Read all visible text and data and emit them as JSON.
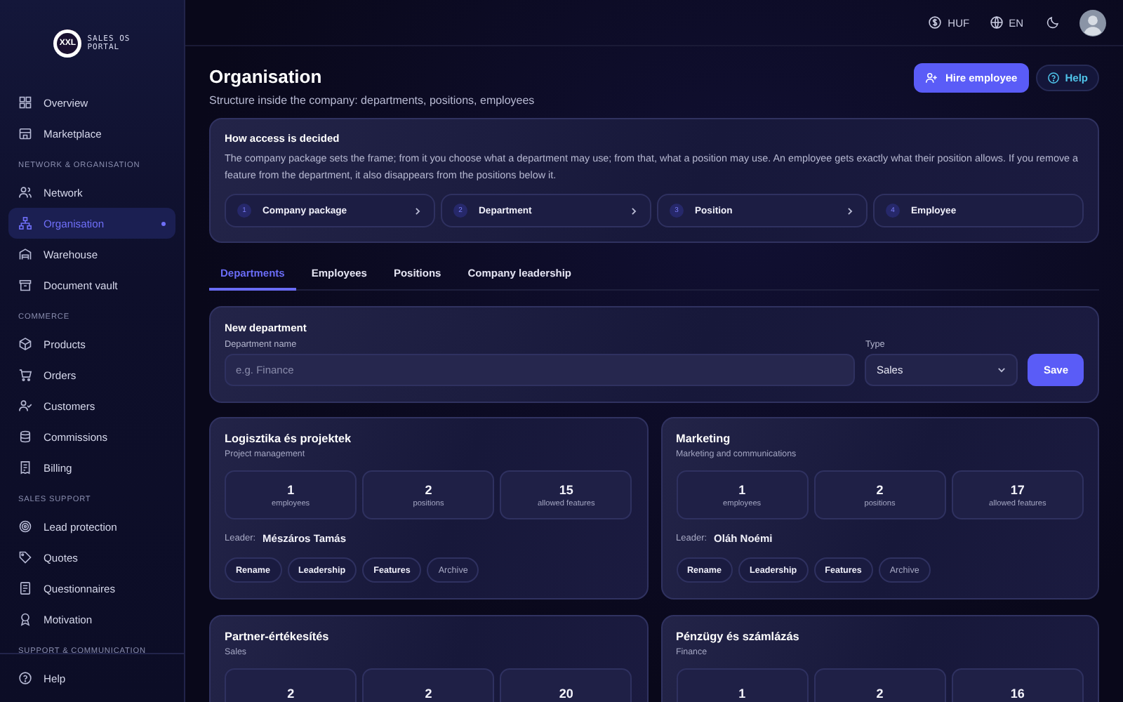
{
  "logo": {
    "mark": "XXL",
    "line_1": "SALES OS",
    "line_2": "PORTAL"
  },
  "sidebar": {
    "sections": [
      {
        "items": [
          {
            "label": "Overview",
            "selected": false
          },
          {
            "label": "Marketplace",
            "selected": false
          }
        ]
      },
      {
        "heading": "NETWORK & ORGANISATION",
        "items": [
          {
            "label": "Network",
            "selected": false
          },
          {
            "label": "Organisation",
            "selected": true
          },
          {
            "label": "Warehouse",
            "selected": false
          },
          {
            "label": "Document vault",
            "selected": false
          }
        ]
      },
      {
        "heading": "COMMERCE",
        "items": [
          {
            "label": "Products",
            "selected": false
          },
          {
            "label": "Orders",
            "selected": false
          },
          {
            "label": "Customers",
            "selected": false
          },
          {
            "label": "Commissions",
            "selected": false
          },
          {
            "label": "Billing",
            "selected": false
          }
        ]
      },
      {
        "heading": "SALES SUPPORT",
        "items": [
          {
            "label": "Lead protection",
            "selected": false
          },
          {
            "label": "Quotes",
            "selected": false
          },
          {
            "label": "Questionnaires",
            "selected": false
          },
          {
            "label": "Motivation",
            "selected": false
          }
        ]
      },
      {
        "heading": "SUPPORT & COMMUNICATION"
      }
    ],
    "footer": {
      "label": "Help"
    }
  },
  "topbar": {
    "currency": "HUF",
    "language": "EN"
  },
  "header": {
    "title": "Organisation",
    "subtitle": "Structure inside the company: departments, positions, employees",
    "primary_button": "Hire employee",
    "help_button": "Help"
  },
  "info": {
    "title": "How access is decided",
    "text": "The company package sets the frame; from it you choose what a department may use; from that, what a position may use. An employee gets exactly what their position allows. If you remove a feature from the department, it also disappears from the positions below it.",
    "steps": [
      {
        "number": "1",
        "label": "Company package"
      },
      {
        "number": "2",
        "label": "Department"
      },
      {
        "number": "3",
        "label": "Position"
      },
      {
        "number": "4",
        "label": "Employee"
      }
    ]
  },
  "tabs": [
    {
      "label": "Departments",
      "selected": true
    },
    {
      "label": "Employees",
      "selected": false
    },
    {
      "label": "Positions",
      "selected": false
    },
    {
      "label": "Company leadership",
      "selected": false
    }
  ],
  "new_department": {
    "title": "New department",
    "name_label": "Department name",
    "name_placeholder": "e.g. Finance",
    "type_label": "Type",
    "type_value": "Sales",
    "save_button": "Save"
  },
  "departments": [
    {
      "name": "Logisztika és projektek",
      "type": "Project management",
      "stats": [
        {
          "value": "1",
          "label": "employees"
        },
        {
          "value": "2",
          "label": "positions"
        },
        {
          "value": "15",
          "label": "allowed features"
        }
      ],
      "leader_label": "Leader:",
      "leader": "Mészáros Tamás",
      "actions": [
        "Rename",
        "Leadership",
        "Features",
        "Archive"
      ]
    },
    {
      "name": "Marketing",
      "type": "Marketing and communications",
      "stats": [
        {
          "value": "1",
          "label": "employees"
        },
        {
          "value": "2",
          "label": "positions"
        },
        {
          "value": "17",
          "label": "allowed features"
        }
      ],
      "leader_label": "Leader:",
      "leader": "Oláh Noémi",
      "actions": [
        "Rename",
        "Leadership",
        "Features",
        "Archive"
      ]
    },
    {
      "name": "Partner-értékesítés",
      "type": "Sales",
      "stats": [
        {
          "value": "2"
        },
        {
          "value": "2"
        },
        {
          "value": "20"
        }
      ]
    },
    {
      "name": "Pénzügy és számlázás",
      "type": "Finance",
      "stats": [
        {
          "value": "1"
        },
        {
          "value": "2"
        },
        {
          "value": "16"
        }
      ]
    }
  ]
}
